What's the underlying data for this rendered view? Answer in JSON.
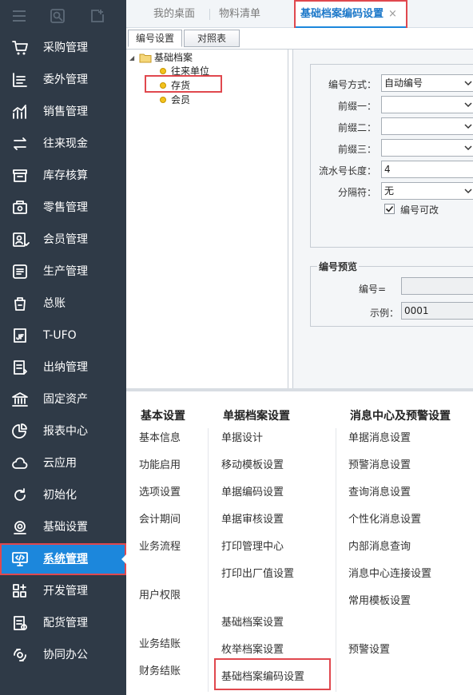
{
  "sidebar": {
    "top_icons": [
      "menu-icon",
      "search-icon",
      "new-window-icon"
    ],
    "items": [
      {
        "label": "采购管理",
        "icon": "cart-icon"
      },
      {
        "label": "委外管理",
        "icon": "outsource-icon"
      },
      {
        "label": "销售管理",
        "icon": "chart-icon"
      },
      {
        "label": "往来现金",
        "icon": "transfer-icon"
      },
      {
        "label": "库存核算",
        "icon": "inventory-icon"
      },
      {
        "label": "零售管理",
        "icon": "retail-icon"
      },
      {
        "label": "会员管理",
        "icon": "member-icon"
      },
      {
        "label": "生产管理",
        "icon": "production-icon"
      },
      {
        "label": "总账",
        "icon": "ledger-icon"
      },
      {
        "label": "T-UFO",
        "icon": "ufo-icon"
      },
      {
        "label": "出纳管理",
        "icon": "cashier-icon"
      },
      {
        "label": "固定资产",
        "icon": "bank-icon"
      },
      {
        "label": "报表中心",
        "icon": "pie-icon"
      },
      {
        "label": "云应用",
        "icon": "cloud-icon"
      },
      {
        "label": "初始化",
        "icon": "refresh-icon"
      },
      {
        "label": "基础设置",
        "icon": "settings-icon"
      },
      {
        "label": "系统管理",
        "icon": "monitor-code-icon"
      },
      {
        "label": "开发管理",
        "icon": "grid-plus-icon"
      },
      {
        "label": "配货管理",
        "icon": "delivery-icon"
      },
      {
        "label": "协同办公",
        "icon": "collab-icon"
      }
    ],
    "active_index": 16
  },
  "tabs": [
    {
      "label": "我的桌面"
    },
    {
      "label": "物料清单"
    },
    {
      "label": "基础档案编码设置",
      "close": "×"
    }
  ],
  "subtabs": [
    {
      "label": "编号设置"
    },
    {
      "label": "对照表"
    }
  ],
  "tree": {
    "expand_icon": "◢",
    "root": "基础档案",
    "children": [
      "往来单位",
      "存货",
      "会员"
    ]
  },
  "form": {
    "numbering_method": {
      "label": "编号方式：",
      "value": "自动编号"
    },
    "prefix1": {
      "label": "前缀一：",
      "value": ""
    },
    "prefix2": {
      "label": "前缀二：",
      "value": ""
    },
    "prefix3": {
      "label": "前缀三：",
      "value": ""
    },
    "serial_length": {
      "label": "流水号长度：",
      "value": "4"
    },
    "separator": {
      "label": "分隔符：",
      "value": "无"
    },
    "editable": {
      "label": "编号可改",
      "checked": true
    }
  },
  "preview": {
    "title": "编号预览",
    "code_label": "编号=",
    "code_value": "",
    "example_label": "示例：",
    "example_value": "0001"
  },
  "settings": {
    "columns": [
      {
        "title": "基本设置",
        "items": [
          "基本信息",
          "功能启用",
          "选项设置",
          "会计期间",
          "业务流程",
          "用户权限",
          "业务结账",
          "财务结账"
        ]
      },
      {
        "title": "单据档案设置",
        "items": [
          "单据设计",
          "移动模板设置",
          "单据编码设置",
          "单据审核设置",
          "打印管理中心",
          "打印出厂值设置",
          "基础档案设置",
          "枚举档案设置",
          "基础档案编码设置"
        ]
      },
      {
        "title": "消息中心及预警设置",
        "items": [
          "单据消息设置",
          "预警消息设置",
          "查询消息设置",
          "个性化消息设置",
          "内部消息查询",
          "消息中心连接设置",
          "常用模板设置",
          "预警设置"
        ]
      }
    ]
  },
  "colors": {
    "sidebar_bg": "#2f3a47",
    "active_bg": "#1c87dc",
    "highlight_border": "#e0484e",
    "tab_active": "#1c78c9"
  }
}
